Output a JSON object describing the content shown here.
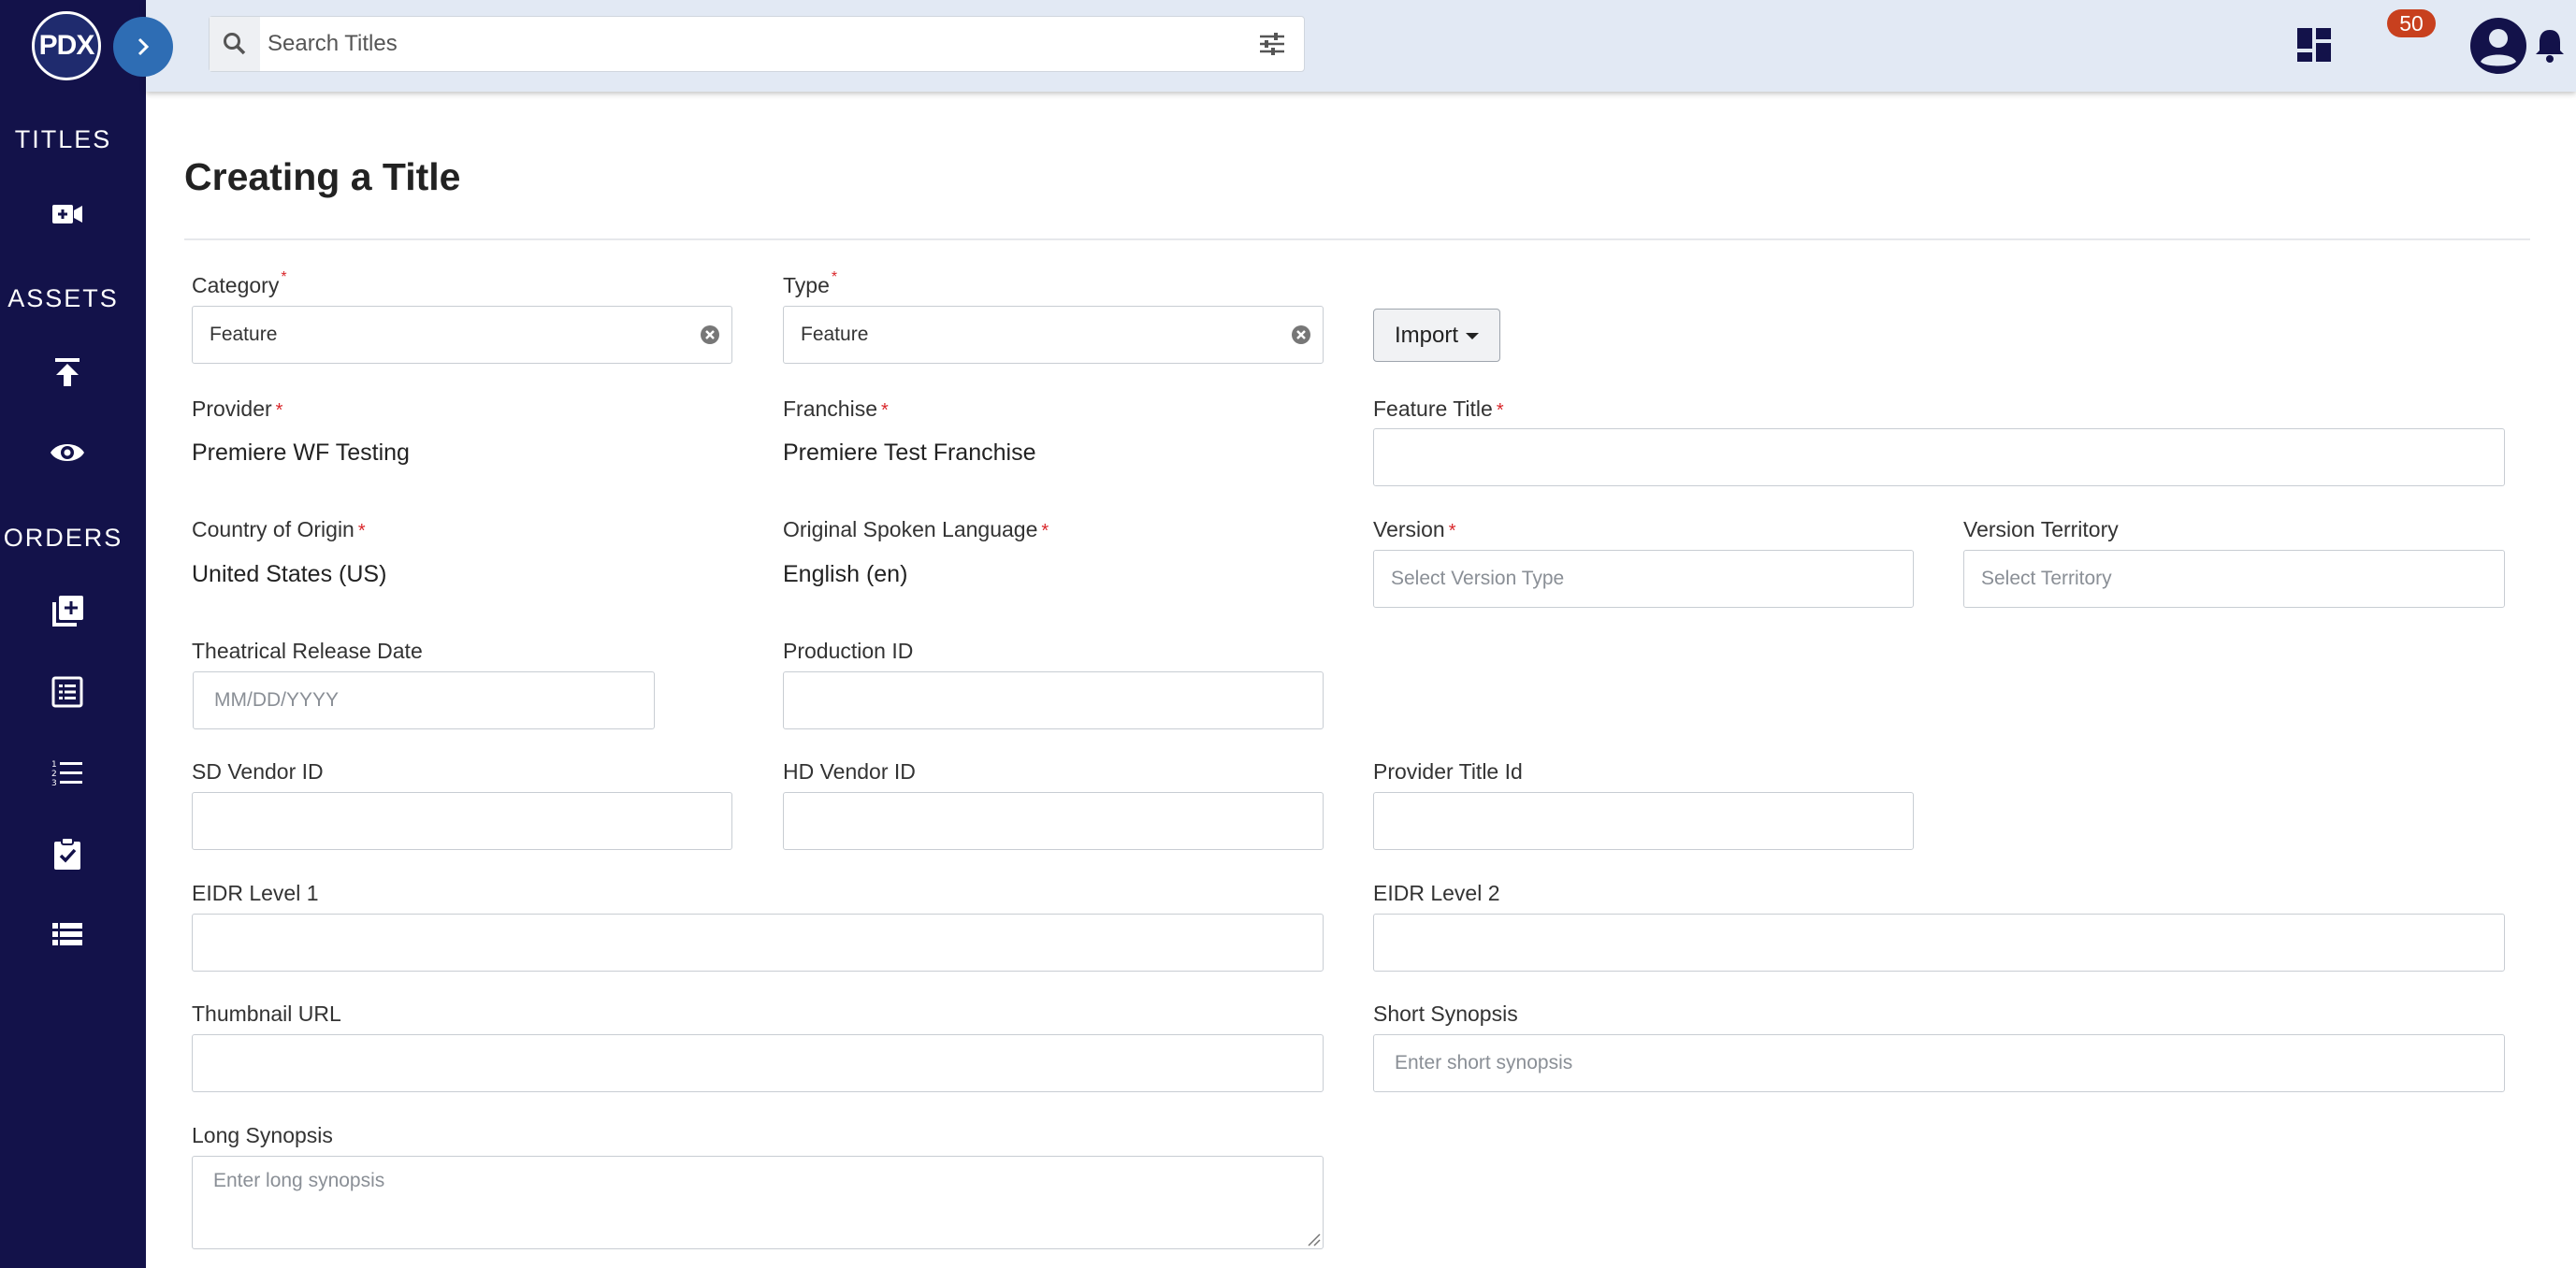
{
  "logo": {
    "text": "PDX"
  },
  "sidebar": {
    "sections": [
      {
        "label": "TITLES"
      },
      {
        "label": "ASSETS"
      },
      {
        "label": "ORDERS"
      }
    ]
  },
  "search": {
    "placeholder": "Search Titles"
  },
  "notifications": {
    "count": "50"
  },
  "page": {
    "title": "Creating a Title"
  },
  "form": {
    "category": {
      "label": "Category",
      "value": "Feature"
    },
    "type": {
      "label": "Type",
      "value": "Feature"
    },
    "import_label": "Import",
    "provider": {
      "label": "Provider",
      "value": "Premiere WF Testing"
    },
    "franchise": {
      "label": "Franchise",
      "value": "Premiere Test Franchise"
    },
    "feature_title": {
      "label": "Feature Title"
    },
    "country": {
      "label": "Country of Origin",
      "value": "United States (US)"
    },
    "language": {
      "label": "Original Spoken Language",
      "value": "English (en)"
    },
    "version": {
      "label": "Version",
      "placeholder": "Select Version Type"
    },
    "version_territory": {
      "label": "Version Territory",
      "placeholder": "Select Territory"
    },
    "release_date": {
      "label": "Theatrical Release Date",
      "placeholder": "MM/DD/YYYY"
    },
    "production_id": {
      "label": "Production ID"
    },
    "sd_vendor_id": {
      "label": "SD Vendor ID"
    },
    "hd_vendor_id": {
      "label": "HD Vendor ID"
    },
    "provider_title_id": {
      "label": "Provider Title Id"
    },
    "eidr1": {
      "label": "EIDR Level 1"
    },
    "eidr2": {
      "label": "EIDR Level 2"
    },
    "thumbnail_url": {
      "label": "Thumbnail URL"
    },
    "short_synopsis": {
      "label": "Short Synopsis",
      "placeholder": "Enter short synopsis"
    },
    "long_synopsis": {
      "label": "Long Synopsis",
      "placeholder": "Enter long synopsis"
    },
    "required_marker": "*"
  },
  "colors": {
    "sidebar": "#13124a",
    "topbar": "#e2e9f4",
    "accent": "#2e6db4",
    "badge": "#c8401e",
    "required": "#d9262a"
  },
  "icons": {
    "sidebar": [
      "add-video-icon",
      "upload-icon",
      "eye-icon",
      "add-library-icon",
      "list-alt-icon",
      "numbered-list-icon",
      "assignment-check-icon",
      "view-list-icon"
    ],
    "topbar": [
      "search-icon",
      "filter-settings-icon",
      "dashboard-icon",
      "bell-icon",
      "account-circle-icon"
    ]
  }
}
